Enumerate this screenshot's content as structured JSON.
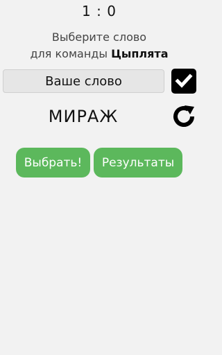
{
  "score": "1 : 0",
  "prompt": {
    "line1": "Выберите слово",
    "line2_prefix": "для команды ",
    "team_name": "Цыплята"
  },
  "word_input": {
    "placeholder": "Ваше слово",
    "value": ""
  },
  "current_word": "МИРАЖ",
  "buttons": {
    "choose": "Выбрать!",
    "results": "Результаты"
  },
  "colors": {
    "background": "#f2f2f2",
    "button_green": "#5cb85c",
    "icon_black": "#000000"
  },
  "icons": {
    "confirm": "checkbox-check-icon",
    "refresh": "refresh-icon"
  }
}
